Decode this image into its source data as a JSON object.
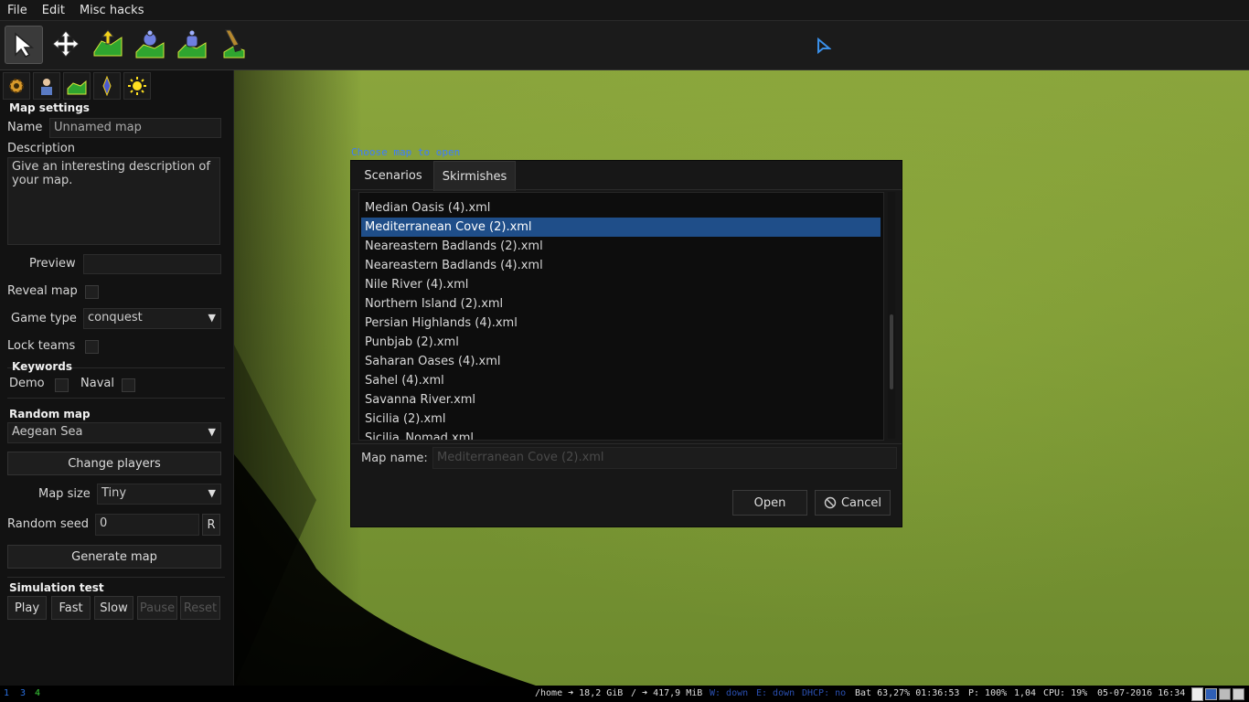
{
  "menu": [
    "File",
    "Edit",
    "Misc hacks"
  ],
  "toolbar": {
    "tools": [
      "select-tool-icon",
      "move-tool-icon",
      "elevation-tool-icon",
      "paint-terrain-tool-icon",
      "place-object-tool-icon",
      "paint-brush-tool-icon"
    ]
  },
  "left_panel": {
    "tabs": [
      "settings-tab-icon",
      "player-tab-icon",
      "terrain-tab-icon",
      "object-tab-icon",
      "environment-tab-icon"
    ],
    "map_settings": {
      "heading": "Map settings",
      "name_label": "Name",
      "name_placeholder": "Unnamed map",
      "description_label": "Description",
      "description_text": "Give an interesting description of your map.",
      "preview_label": "Preview",
      "reveal_map_label": "Reveal map",
      "game_type_label": "Game type",
      "game_type_value": "conquest",
      "lock_teams_label": "Lock teams"
    },
    "keywords": {
      "heading": "Keywords",
      "demo_label": "Demo",
      "naval_label": "Naval"
    },
    "random_map": {
      "heading": "Random map",
      "script_value": "Aegean Sea",
      "change_players_label": "Change players",
      "map_size_label": "Map size",
      "map_size_value": "Tiny",
      "random_seed_label": "Random seed",
      "random_seed_value": "0",
      "reroll_label": "R",
      "generate_label": "Generate map"
    },
    "simulation": {
      "heading": "Simulation test",
      "play": "Play",
      "fast": "Fast",
      "slow": "Slow",
      "pause": "Pause",
      "reset": "Reset"
    }
  },
  "dialog": {
    "caption": "Choose map to open",
    "tabs": [
      "Scenarios",
      "Skirmishes"
    ],
    "active_tab": "Skirmishes",
    "files": [
      "Median Oasis (4).xml",
      "Mediterranean Cove (2).xml",
      "Neareastern Badlands (2).xml",
      "Neareastern Badlands (4).xml",
      "Nile River (4).xml",
      "Northern Island (2).xml",
      "Persian Highlands (4).xml",
      "Punbjab (2).xml",
      "Saharan Oases (4).xml",
      "Sahel (4).xml",
      "Savanna River.xml",
      "Sicilia (2).xml",
      "Sicilia_Nomad.xml"
    ],
    "selected_file": "Mediterranean Cove (2).xml",
    "map_name_label": "Map name:",
    "map_name_placeholder": "Mediterranean Cove (2).xml",
    "open_label": "Open",
    "cancel_label": "Cancel"
  },
  "statusbar": {
    "workspaces": [
      "1",
      "3",
      "4"
    ],
    "home": "/home ➜ 18,2 GiB",
    "root": "/ ➜ 417,9 MiB",
    "wifi": "W: down",
    "eth": "E: down",
    "dhcp": "DHCP: no",
    "battery": "Bat 63,27% 01:36:53",
    "power": "P: 100%",
    "load": "1,04",
    "cpu": "CPU: 19%",
    "datetime": "05-07-2016 16:34"
  },
  "colors": {
    "selection": "#1f4e89",
    "caption": "#3c7cff",
    "grass": "#7f9b36"
  }
}
